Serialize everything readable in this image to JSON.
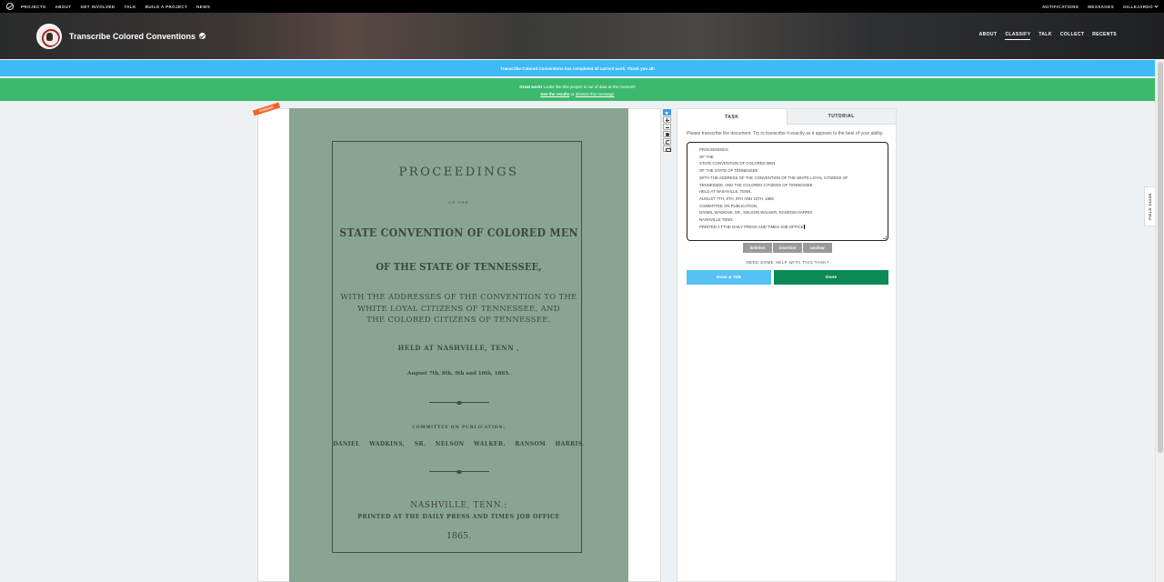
{
  "topnav": {
    "links": [
      "PROJECTS",
      "ABOUT",
      "GET INVOLVED",
      "TALK",
      "BUILD A PROJECT",
      "NEWS"
    ],
    "right": [
      "NOTIFICATIONS",
      "MESSAGES",
      "GILLEJARDO"
    ]
  },
  "project": {
    "title": "Transcribe Colored Conventions",
    "nav": [
      "ABOUT",
      "CLASSIFY",
      "TALK",
      "COLLECT",
      "RECENTS"
    ],
    "active_nav": "CLASSIFY"
  },
  "banners": {
    "complete": "Transcribe Colored Conventions has completed all current work. Thank you all!",
    "great_work_bold": "Great work!",
    "great_work_text": " Looks like this project is out of data at the moment!",
    "see_results": "See the results",
    "or": " or ",
    "dismiss": "dismiss this message"
  },
  "viewer": {
    "finished_tag": "FINISHED",
    "document": {
      "title": "PROCEEDINGS",
      "of_the": "OF THE",
      "convention": "STATE CONVENTION OF COLORED MEN",
      "state": "OF THE STATE OF TENNESSEE,",
      "addresses": [
        "WITH THE ADDRESSES OF THE CONVENTION TO THE",
        "WHITE LOYAL CITIZENS OF TENNESSEE, AND",
        "THE COLORED CITIZENS OF TENNESSEE."
      ],
      "held": "HELD AT NASHVILLE, TENN ,",
      "dates": "August 7th, 8th, 9th and 10th, 1865.",
      "committee": "COMMITTEE ON PUBLICATION:",
      "names": "DANIEL WADKINS, SR.   NELSON WALKER.   RANSOM HARRIS.",
      "city": "NASHVILLE, TENN.:",
      "printer": "PRINTED AT THE DAILY PRESS AND TIMES JOB OFFICE",
      "year": "1865."
    }
  },
  "field_guide": "FIELD GUIDE",
  "task": {
    "tabs": [
      "TASK",
      "TUTORIAL"
    ],
    "instructions": "Please transcribe the document. Try to transcribe it exactly as it appears to the best of your ability.",
    "transcription": [
      "PROCEEDINGS",
      "OF THE",
      "STATE CONVENTION OF COLORED MEN",
      "OF THE STATE OF TENNESSEE",
      "WITH THE ADDRESS OF THE CONVENTION OF THE WHITE LOYAL CITIZENS OF",
      "TENNESSEE, AND THE COLORED CITIZENS OF TENNESSEE.",
      "HELD AT NASHVILLE, TENN,",
      "AUGUST 7TH, 8TH, 9TH AND 10TH, 1865",
      "COMMITTEE ON PUBLICATION,",
      "DANIEL WADKINS, SR., NELSON WALKER, RANDOM HARRIS",
      "NASHVILLE TENN.",
      "PRINTED A TTHE DAILY PRESS AND TIMES JOB OFFICE"
    ],
    "tags": [
      "deletion",
      "insertion",
      "unclear"
    ],
    "help": "NEED SOME HELP WITH THIS TASK?",
    "done_talk": "Done & Talk",
    "done": "Done"
  },
  "colors": {
    "banner_blue": "#3fbaf7",
    "banner_green": "#3bba6e",
    "done_green": "#0b8a55",
    "paper": "#8aa494"
  }
}
